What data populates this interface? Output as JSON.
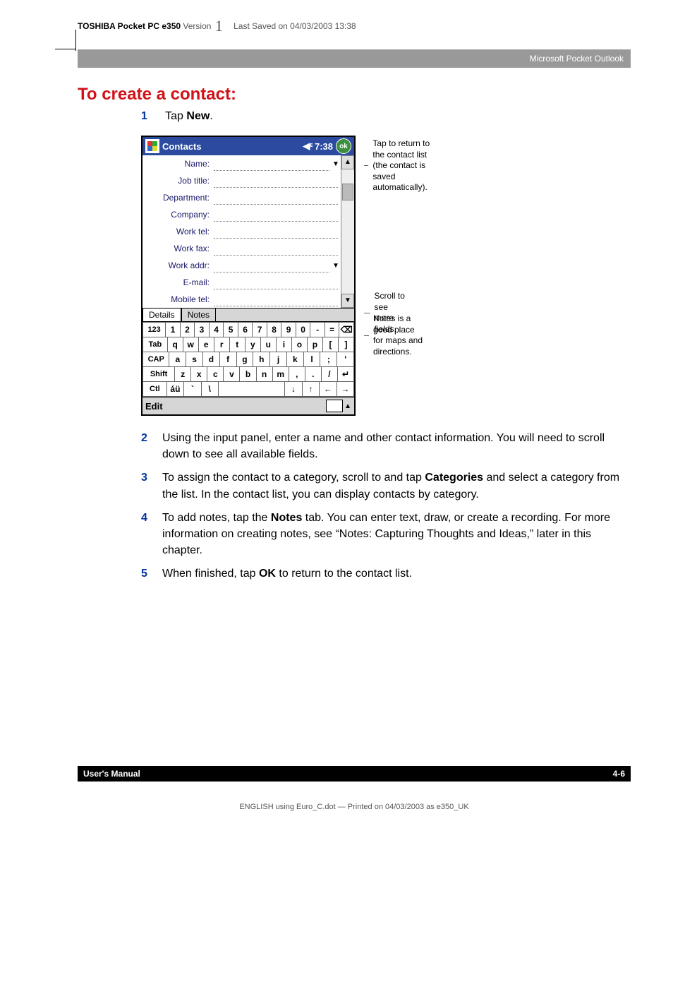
{
  "header": {
    "product": "TOSHIBA Pocket PC e350",
    "version_word": "Version",
    "version_num": "1",
    "saved": "Last Saved on 04/03/2003 13:38"
  },
  "band": {
    "text": "Microsoft Pocket Outlook"
  },
  "section_title": "To create a contact:",
  "step1": {
    "num": "1",
    "pre": "Tap ",
    "bold": "New",
    "post": "."
  },
  "ppc": {
    "title": "Contacts",
    "time": "7:38",
    "ok": "ok",
    "fields": [
      "Name:",
      "Job title:",
      "Department:",
      "Company:",
      "Work tel:",
      "Work fax:",
      "Work addr:",
      "E-mail:",
      "Mobile tel:"
    ],
    "tabs": {
      "details": "Details",
      "notes": "Notes"
    },
    "kbd": {
      "r1": [
        "123",
        "1",
        "2",
        "3",
        "4",
        "5",
        "6",
        "7",
        "8",
        "9",
        "0",
        "-",
        "=",
        "⌫"
      ],
      "r2": [
        "Tab",
        "q",
        "w",
        "e",
        "r",
        "t",
        "y",
        "u",
        "i",
        "o",
        "p",
        "[",
        "]"
      ],
      "r3": [
        "CAP",
        "a",
        "s",
        "d",
        "f",
        "g",
        "h",
        "j",
        "k",
        "l",
        ";",
        "'"
      ],
      "r4": [
        "Shift",
        "z",
        "x",
        "c",
        "v",
        "b",
        "n",
        "m",
        ",",
        ".",
        "/",
        "↵"
      ],
      "r5": [
        "Ctl",
        "áü",
        "`",
        "\\",
        " ",
        "↓",
        "↑",
        "←",
        "→"
      ]
    },
    "edit": "Edit"
  },
  "callouts": {
    "ok": "Tap to return to the contact list (the contact is saved automatically).",
    "scroll": "Scroll to see more fields.",
    "notes": "Notes is a good place for maps and directions."
  },
  "steps_after": [
    {
      "num": "2",
      "body": "Using the input panel, enter a name and other contact information. You will need to scroll down to see all available fields."
    },
    {
      "num": "3",
      "body_pre": "To assign the contact to a category, scroll to and tap ",
      "bold": "Categories",
      "body_post": " and select a category from the list. In the contact list, you can display contacts by category."
    },
    {
      "num": "4",
      "body_pre": "To add notes, tap the ",
      "bold": "Notes",
      "body_post": " tab. You can enter text, draw, or create a recording. For more information on creating notes, see “Notes: Capturing Thoughts and Ideas,” later in this chapter."
    },
    {
      "num": "5",
      "body_pre": "When finished, tap ",
      "bold": "OK",
      "body_post": " to return to the contact list."
    }
  ],
  "footer": {
    "left": "User's Manual",
    "right": "4-6"
  },
  "print": "ENGLISH using  Euro_C.dot — Printed on 04/03/2003 as e350_UK"
}
